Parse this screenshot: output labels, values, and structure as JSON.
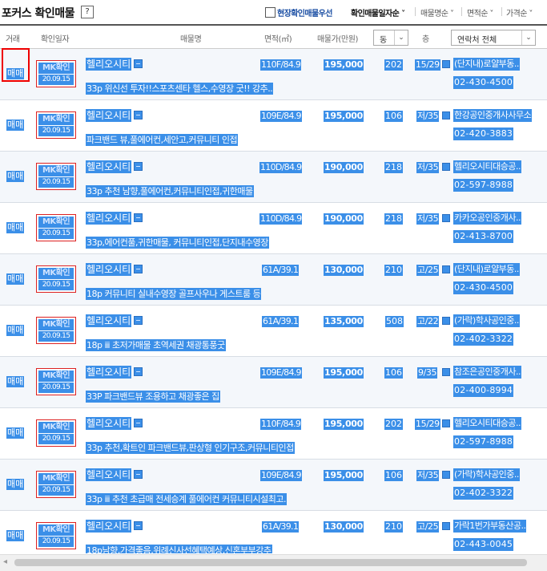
{
  "header": {
    "title": "포커스 확인매물",
    "help": "?",
    "checkbox_label": "현장확인매물우선",
    "sort": [
      {
        "label": "확인매물일자순 ˅",
        "active": true
      },
      {
        "label": "매물명순 ˅",
        "active": false
      },
      {
        "label": "면적순 ˅",
        "active": false
      },
      {
        "label": "가격순 ˅",
        "active": false
      }
    ]
  },
  "columns": {
    "trade": "거래",
    "confirm_date": "확인일자",
    "name": "매물명",
    "area": "면적(㎡)",
    "price": "매물가(만원)",
    "dong_select": "동",
    "floor": "층",
    "contact_select": "연락처 전체"
  },
  "rows": [
    {
      "trade": "매매",
      "badge": "MK확인",
      "date": "20.09.15",
      "name": "헬리오시티",
      "desc": "33p 위신선 투자!!스포츠센타 헬스,수영장 굿!! 강추..",
      "area": "110F/84.9",
      "price": "195,000",
      "dong": "202",
      "floor": "15/29",
      "agent": "(단지내)로얄부동..",
      "phone": "02-430-4500"
    },
    {
      "trade": "매매",
      "badge": "MK확인",
      "date": "20.09.15",
      "name": "헬리오시티",
      "desc": "파크밴드 뷰,풀에어컨,세안고,커뮤니티 인접",
      "area": "109E/84.9",
      "price": "195,000",
      "dong": "106",
      "floor": "저/35",
      "agent": "한강공인중개사사무소",
      "phone": "02-420-3883"
    },
    {
      "trade": "매매",
      "badge": "MK확인",
      "date": "20.09.15",
      "name": "헬리오시티",
      "desc": "33p 추천 남향,풀에어컨,커뮤니티인접,귀한매물",
      "area": "110D/84.9",
      "price": "190,000",
      "dong": "218",
      "floor": "저/35",
      "agent": "헬리오시티대승공..",
      "phone": "02-597-8988"
    },
    {
      "trade": "매매",
      "badge": "MK확인",
      "date": "20.09.15",
      "name": "헬리오시티",
      "desc": "33p,에어컨풀,귀한매물, 커뮤니티인접,단지내수영장",
      "area": "110D/84.9",
      "price": "190,000",
      "dong": "218",
      "floor": "저/35",
      "agent": "카카오공인중개사..",
      "phone": "02-413-8700"
    },
    {
      "trade": "매매",
      "badge": "MK확인",
      "date": "20.09.15",
      "name": "헬리오시티",
      "desc": "18p 커뮤니티 실내수영장 골프사우나 게스트룸 등",
      "area": "61A/39.1",
      "price": "130,000",
      "dong": "210",
      "floor": "고/25",
      "agent": "(단지내)로얄부동..",
      "phone": "02-430-4500"
    },
    {
      "trade": "매매",
      "badge": "MK확인",
      "date": "20.09.15",
      "name": "헬리오시티",
      "desc": "18p ⅲ 초저가매물 초역세권 채광통풍굿",
      "area": "61A/39.1",
      "price": "135,000",
      "dong": "508",
      "floor": "고/22",
      "agent": "(가락)학사공인중..",
      "phone": "02-402-3322"
    },
    {
      "trade": "매매",
      "badge": "MK확인",
      "date": "20.09.15",
      "name": "헬리오시티",
      "desc": "33P 파크밴드뷰 조용하고 채광좋은 집",
      "area": "109E/84.9",
      "price": "195,000",
      "dong": "106",
      "floor": "9/35",
      "agent": "참조은공인중개사..",
      "phone": "02-400-8994"
    },
    {
      "trade": "매매",
      "badge": "MK확인",
      "date": "20.09.15",
      "name": "헬리오시티",
      "desc": "33p 추천,확트인 파크밴드뷰,판상형 인기구조,커뮤니티인접",
      "area": "110F/84.9",
      "price": "195,000",
      "dong": "202",
      "floor": "15/29",
      "agent": "헬리오시티대승공..",
      "phone": "02-597-8988"
    },
    {
      "trade": "매매",
      "badge": "MK확인",
      "date": "20.09.15",
      "name": "헬리오시티",
      "desc": "33p ⅲ 추천 초급매 전세승계 풀에어컨 커뮤니티시설최고.",
      "area": "109E/84.9",
      "price": "195,000",
      "dong": "106",
      "floor": "저/35",
      "agent": "(가락)학사공인중..",
      "phone": "02-402-3322"
    },
    {
      "trade": "매매",
      "badge": "MK확인",
      "date": "20.09.15",
      "name": "헬리오시티",
      "desc": "18p남향,가격좋음,위례신사선혜택예상,신혼부부강추",
      "area": "61A/39.1",
      "price": "130,000",
      "dong": "210",
      "floor": "고/25",
      "agent": "가락1번가부동산공..",
      "phone": "02-443-0045"
    }
  ],
  "scrollbar": {
    "left_arrow": "◂"
  }
}
